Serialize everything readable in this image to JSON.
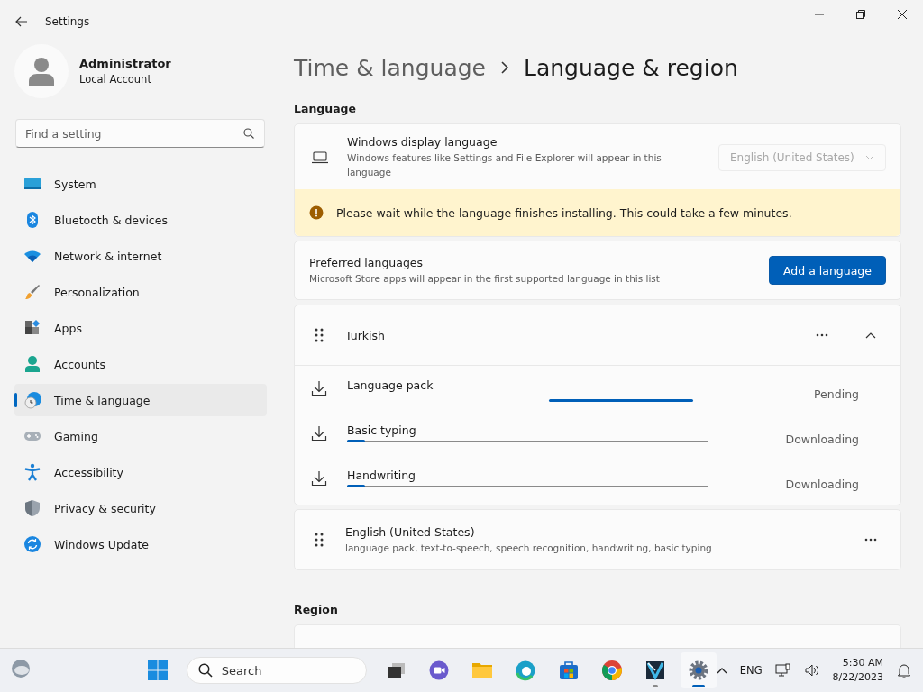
{
  "window": {
    "title": "Settings"
  },
  "account": {
    "name": "Administrator",
    "type": "Local Account"
  },
  "search": {
    "placeholder": "Find a setting"
  },
  "nav": [
    {
      "label": "System",
      "kind": "system",
      "selected": false
    },
    {
      "label": "Bluetooth & devices",
      "kind": "bluetooth",
      "selected": false
    },
    {
      "label": "Network & internet",
      "kind": "wifi",
      "selected": false
    },
    {
      "label": "Personalization",
      "kind": "brush",
      "selected": false
    },
    {
      "label": "Apps",
      "kind": "apps",
      "selected": false
    },
    {
      "label": "Accounts",
      "kind": "person",
      "selected": false
    },
    {
      "label": "Time & language",
      "kind": "globe",
      "selected": true
    },
    {
      "label": "Gaming",
      "kind": "gamepad",
      "selected": false
    },
    {
      "label": "Accessibility",
      "kind": "accessibility",
      "selected": false
    },
    {
      "label": "Privacy & security",
      "kind": "shield",
      "selected": false
    },
    {
      "label": "Windows Update",
      "kind": "update",
      "selected": false
    }
  ],
  "breadcrumb": {
    "parent": "Time & language",
    "current": "Language & region"
  },
  "language": {
    "heading": "Language",
    "display_language": {
      "title": "Windows display language",
      "description": "Windows features like Settings and File Explorer will appear in this language",
      "value": "English (United States)",
      "disabled": true
    },
    "notice": "Please wait while the language finishes installing. This could take a few minutes.",
    "preferred": {
      "title": "Preferred languages",
      "description": "Microsoft Store apps will appear in the first supported language in this list",
      "button": "Add a language"
    },
    "languages": [
      {
        "name": "Turkish",
        "expanded": true,
        "features": [
          {
            "name": "Language pack",
            "status": "Pending",
            "kind": "indeterminate"
          },
          {
            "name": "Basic typing",
            "status": "Downloading",
            "kind": "determinate",
            "level": 0.05
          },
          {
            "name": "Handwriting",
            "status": "Downloading",
            "kind": "determinate",
            "level": 0.05
          }
        ]
      },
      {
        "name": "English (United States)",
        "description": "language pack, text-to-speech, speech recognition, handwriting, basic typing"
      }
    ]
  },
  "region": {
    "heading": "Region"
  },
  "taskbar": {
    "search_placeholder": "Search",
    "language": "ENG",
    "time": "5:30 AM",
    "date": "8/22/2023",
    "apps": [
      {
        "kind": "task-view",
        "running": false,
        "selected": false
      },
      {
        "kind": "chat",
        "running": false,
        "selected": false
      },
      {
        "kind": "folder",
        "running": false,
        "selected": false
      },
      {
        "kind": "browser",
        "running": false,
        "selected": false
      },
      {
        "kind": "store",
        "running": false,
        "selected": false
      },
      {
        "kind": "chrome",
        "running": false,
        "selected": false
      },
      {
        "kind": "editor",
        "running": true,
        "selected": false
      },
      {
        "kind": "settings",
        "running": true,
        "selected": true
      }
    ]
  }
}
